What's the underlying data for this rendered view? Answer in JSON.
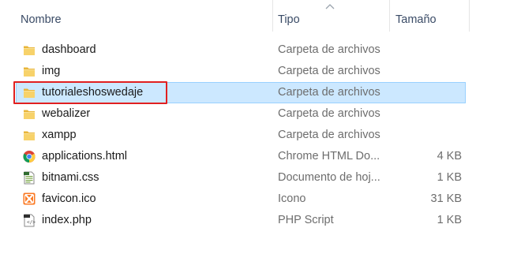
{
  "columns": {
    "name": "Nombre",
    "type": "Tipo",
    "size": "Tamaño"
  },
  "files": [
    {
      "name": "dashboard",
      "type": "Carpeta de archivos",
      "size": "",
      "icon": "folder-icon",
      "selected": false
    },
    {
      "name": "img",
      "type": "Carpeta de archivos",
      "size": "",
      "icon": "folder-icon",
      "selected": false
    },
    {
      "name": "tutorialeshoswedaje",
      "type": "Carpeta de archivos",
      "size": "",
      "icon": "folder-icon",
      "selected": true
    },
    {
      "name": "webalizer",
      "type": "Carpeta de archivos",
      "size": "",
      "icon": "folder-icon",
      "selected": false
    },
    {
      "name": "xampp",
      "type": "Carpeta de archivos",
      "size": "",
      "icon": "folder-icon",
      "selected": false
    },
    {
      "name": "applications.html",
      "type": "Chrome HTML Do...",
      "size": "4 KB",
      "icon": "chrome-icon",
      "selected": false
    },
    {
      "name": "bitnami.css",
      "type": "Documento de hoj...",
      "size": "1 KB",
      "icon": "css-file-icon",
      "selected": false
    },
    {
      "name": "favicon.ico",
      "type": "Icono",
      "size": "31 KB",
      "icon": "xampp-icon",
      "selected": false
    },
    {
      "name": "index.php",
      "type": "PHP Script",
      "size": "1 KB",
      "icon": "php-file-icon",
      "selected": false
    }
  ],
  "colors": {
    "selection_bg": "#cce8ff",
    "selection_border": "#99d1ff",
    "highlight": "#e02020",
    "folder": "#f4c64a"
  }
}
